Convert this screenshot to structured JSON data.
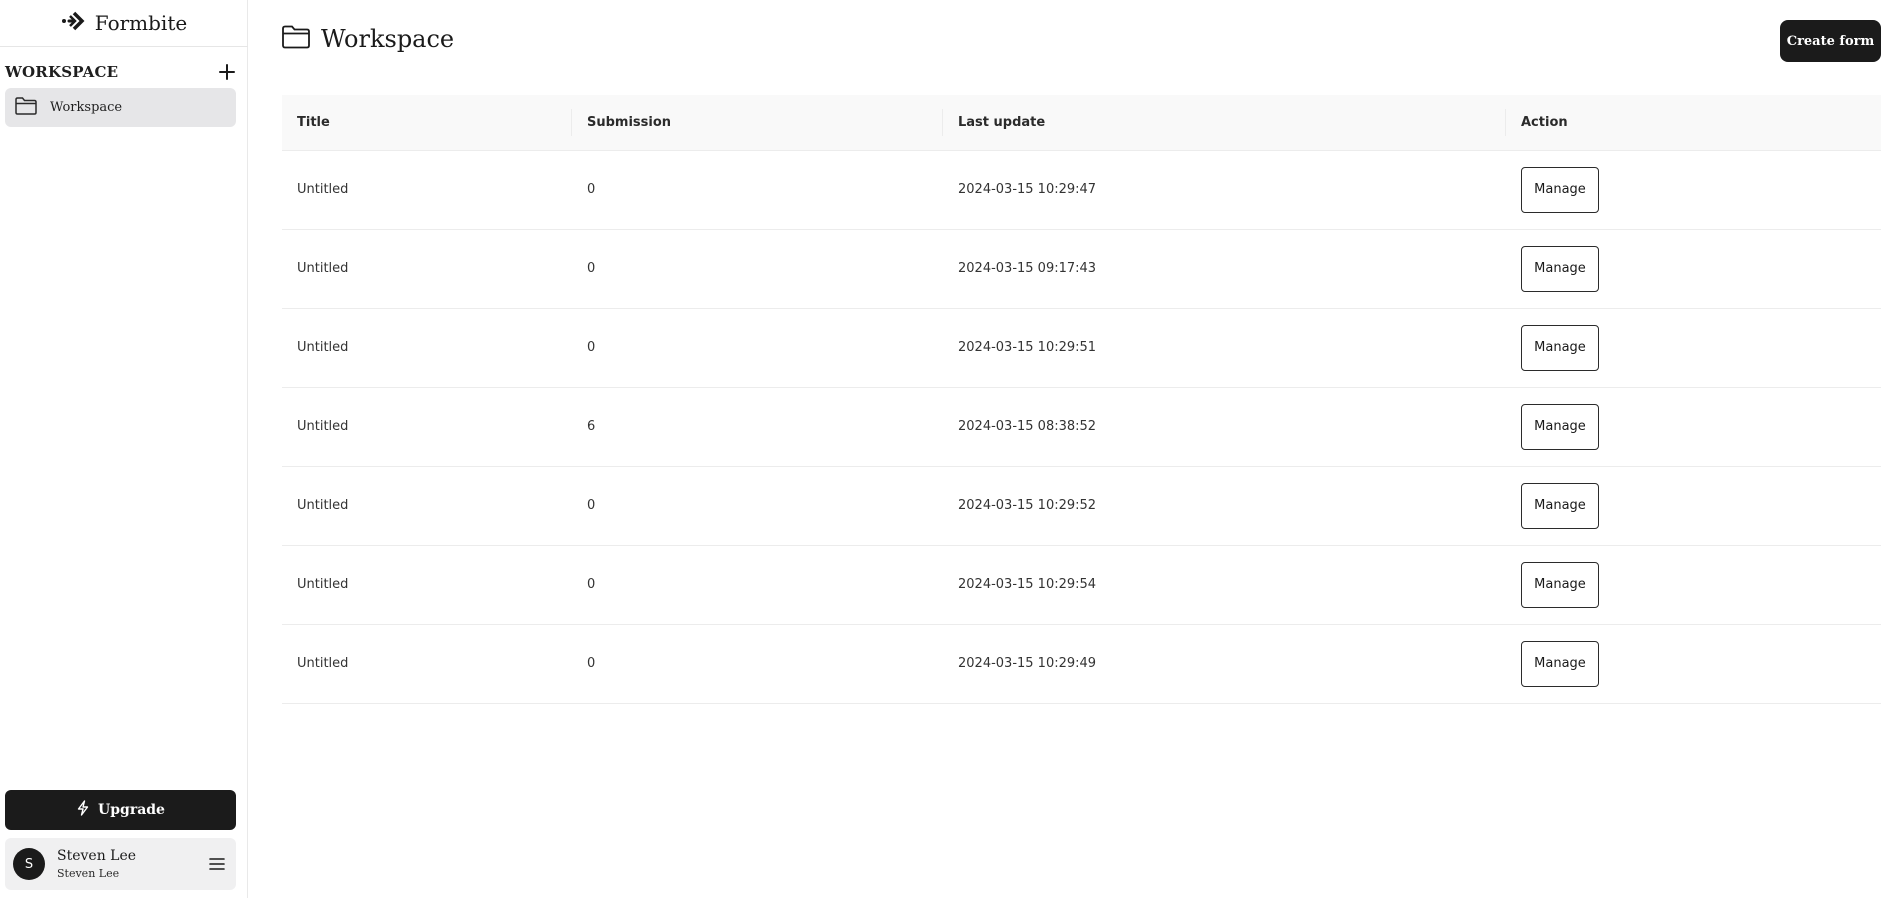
{
  "brand": {
    "name": "Formbite",
    "logo_icon": "chevrons-right-logo-icon"
  },
  "sidebar": {
    "section_title": "WORKSPACE",
    "add_icon": "plus-icon",
    "items": [
      {
        "label": "Workspace",
        "icon": "folder-icon",
        "active": true
      }
    ],
    "upgrade_label": "Upgrade",
    "upgrade_icon": "lightning-icon",
    "user": {
      "initial": "S",
      "name": "Steven Lee",
      "sub": "Steven Lee",
      "menu_icon": "hamburger-menu-icon"
    }
  },
  "main": {
    "title": "Workspace",
    "title_icon": "folder-icon",
    "create_label": "Create form"
  },
  "table": {
    "columns": [
      "Title",
      "Submission",
      "Last update",
      "Action"
    ],
    "rows": [
      {
        "title": "Untitled",
        "submission": "0",
        "updated": "2024-03-15 10:29:47",
        "action": "Manage"
      },
      {
        "title": "Untitled",
        "submission": "0",
        "updated": "2024-03-15 09:17:43",
        "action": "Manage"
      },
      {
        "title": "Untitled",
        "submission": "0",
        "updated": "2024-03-15 10:29:51",
        "action": "Manage"
      },
      {
        "title": "Untitled",
        "submission": "6",
        "updated": "2024-03-15 08:38:52",
        "action": "Manage"
      },
      {
        "title": "Untitled",
        "submission": "0",
        "updated": "2024-03-15 10:29:52",
        "action": "Manage"
      },
      {
        "title": "Untitled",
        "submission": "0",
        "updated": "2024-03-15 10:29:54",
        "action": "Manage"
      },
      {
        "title": "Untitled",
        "submission": "0",
        "updated": "2024-03-15 10:29:49",
        "action": "Manage"
      }
    ]
  },
  "colors": {
    "dark": "#1b1b1b",
    "active_item_bg": "#e6e6e8",
    "header_bg": "#f9f9f9",
    "border": "#ececec"
  }
}
